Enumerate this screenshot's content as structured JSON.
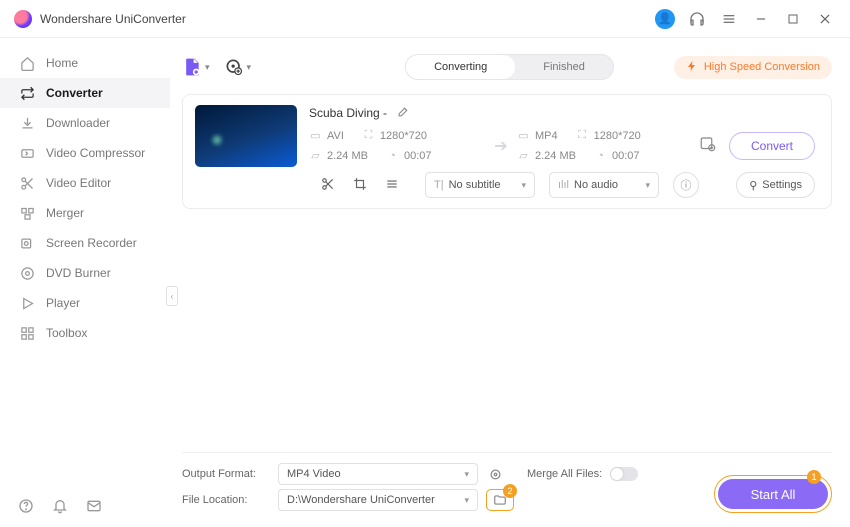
{
  "app": {
    "title": "Wondershare UniConverter"
  },
  "sidebar": {
    "items": [
      {
        "label": "Home"
      },
      {
        "label": "Converter"
      },
      {
        "label": "Downloader"
      },
      {
        "label": "Video Compressor"
      },
      {
        "label": "Video Editor"
      },
      {
        "label": "Merger"
      },
      {
        "label": "Screen Recorder"
      },
      {
        "label": "DVD Burner"
      },
      {
        "label": "Player"
      },
      {
        "label": "Toolbox"
      }
    ]
  },
  "tabs": {
    "converting": "Converting",
    "finished": "Finished"
  },
  "hsc": "High Speed Conversion",
  "file": {
    "title": "Scuba Diving -",
    "src": {
      "fmt": "AVI",
      "res": "1280*720",
      "size": "2.24 MB",
      "dur": "00:07"
    },
    "dst": {
      "fmt": "MP4",
      "res": "1280*720",
      "size": "2.24 MB",
      "dur": "00:07"
    },
    "subtitle": "No subtitle",
    "audio": "No audio",
    "settings": "Settings",
    "convert": "Convert"
  },
  "bottom": {
    "output_format_label": "Output Format:",
    "output_format_value": "MP4 Video",
    "file_location_label": "File Location:",
    "file_location_value": "D:\\Wondershare UniConverter",
    "merge_label": "Merge All Files:"
  },
  "start": "Start All",
  "annotations": {
    "one": "1",
    "two": "2"
  }
}
